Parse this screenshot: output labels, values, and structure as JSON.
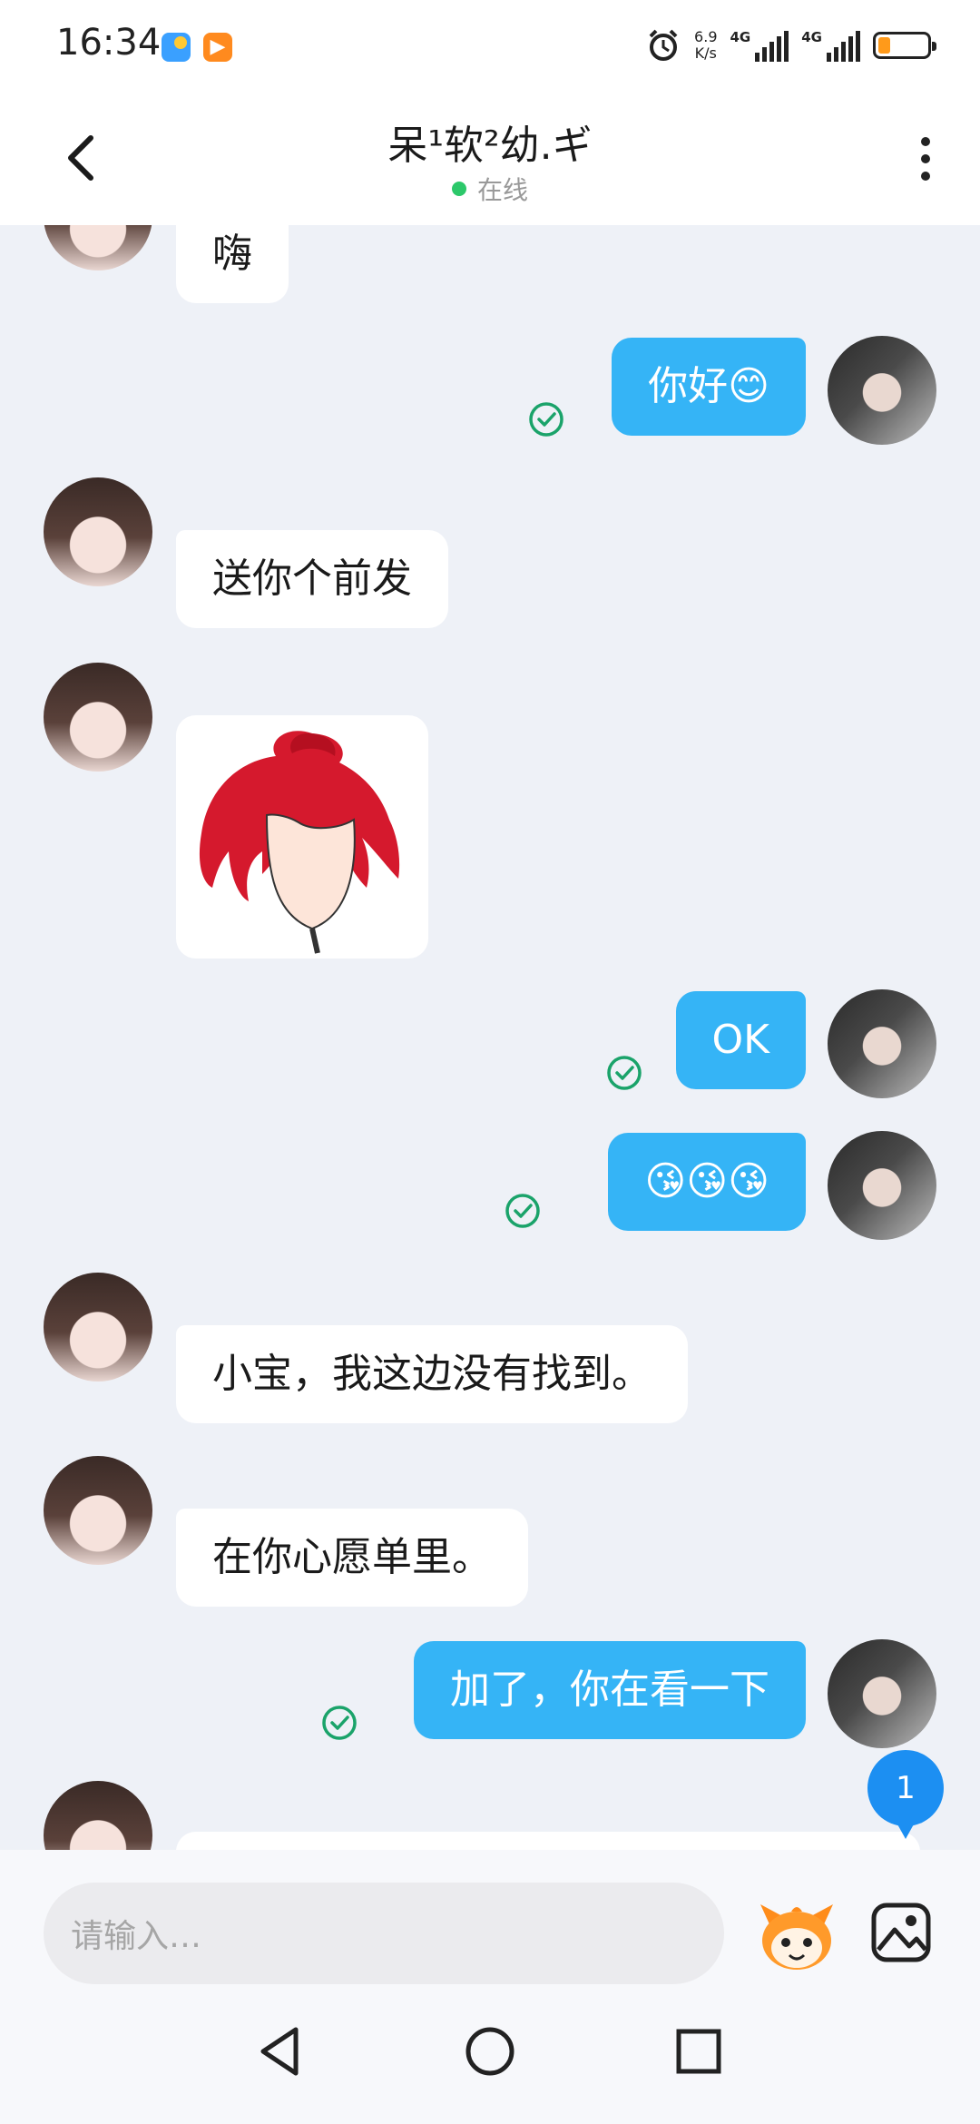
{
  "status_bar": {
    "time": "16:34",
    "speed_value": "6.9",
    "speed_unit": "K/s",
    "network_1": "4G",
    "network_2": "4G",
    "battery_level": 0.25,
    "icons": [
      "weather-app-icon",
      "video-app-icon",
      "alarm-icon",
      "signal-icon",
      "signal-icon",
      "battery-icon"
    ]
  },
  "header": {
    "title": "呆¹软²幼.ギ",
    "status": "在线",
    "back_icon": "chevron-left-icon",
    "more_icon": "more-vertical-icon"
  },
  "messages": [
    {
      "sender": "friend",
      "text": "嗨"
    },
    {
      "sender": "me",
      "text": "你好😊",
      "read": true
    },
    {
      "sender": "friend",
      "text": "送你个前发"
    },
    {
      "sender": "friend",
      "type": "image",
      "image": "red-bangs-wig-sticker"
    },
    {
      "sender": "me",
      "text": "OK",
      "read": true
    },
    {
      "sender": "me",
      "text": "😘😘😘",
      "read": true
    },
    {
      "sender": "friend",
      "text": "小宝，我这边没有找到。"
    },
    {
      "sender": "friend",
      "text": "在你心愿单里。"
    },
    {
      "sender": "me",
      "text": "加了，你在看一下",
      "read": true
    }
  ],
  "unread_badge": "1",
  "input": {
    "placeholder": "请输入…",
    "mascot_icon": "mascot-emoji-icon",
    "image_icon": "image-icon"
  },
  "nav": [
    "back-triangle-icon",
    "home-circle-icon",
    "recents-square-icon"
  ],
  "colors": {
    "outgoing_bubble": "#35b4f6",
    "incoming_bubble": "#ffffff",
    "background": "#eef1f7",
    "online_dot": "#2cc86a",
    "read_check": "#1aa36a",
    "unread_badge": "#1c8ff2"
  }
}
